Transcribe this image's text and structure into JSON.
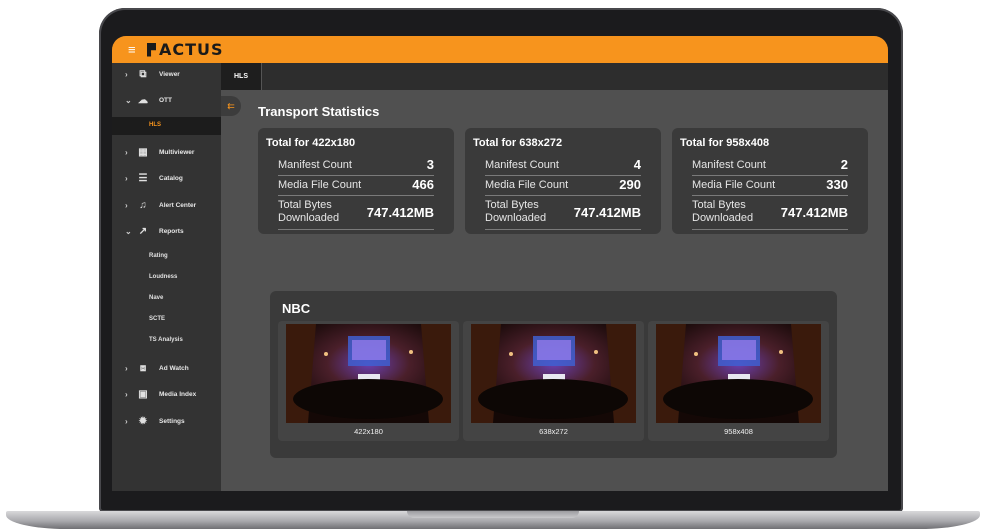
{
  "app": {
    "logo": "ACTUS",
    "menu_glyph": "≡",
    "accent_color": "#f7941d",
    "background": "#505050"
  },
  "sidebar": {
    "items": [
      {
        "label": "Viewer",
        "icon": "monitor-icon",
        "glyph": "⧉",
        "chevron": "›"
      },
      {
        "label": "OTT",
        "icon": "cloud-icon",
        "glyph": "☁",
        "chevron": "⌄"
      },
      {
        "label": "Multiviewer",
        "icon": "grid-icon",
        "glyph": "▦",
        "chevron": "›"
      },
      {
        "label": "Catalog",
        "icon": "list-icon",
        "glyph": "☰",
        "chevron": "›"
      },
      {
        "label": "Alert Center",
        "icon": "bell-icon",
        "glyph": "♫",
        "chevron": "›"
      },
      {
        "label": "Reports",
        "icon": "trend-icon",
        "glyph": "↗",
        "chevron": "⌄"
      },
      {
        "label": "Ad Watch",
        "icon": "ad-icon",
        "glyph": "⧈",
        "chevron": "›"
      },
      {
        "label": "Media Index",
        "icon": "film-icon",
        "glyph": "▣",
        "chevron": "›"
      },
      {
        "label": "Settings",
        "icon": "gear-icon",
        "glyph": "✹",
        "chevron": "›"
      }
    ],
    "ott_sub": [
      "HLS"
    ],
    "reports_sub": [
      "Rating",
      "Loudness",
      "Nave",
      "SCTE",
      "TS Analysis"
    ]
  },
  "tabs": [
    "HLS"
  ],
  "collapse_glyph": "⇇",
  "main": {
    "title": "Transport Statistics",
    "cards": [
      {
        "title": "Total for 422x180",
        "manifest_label": "Manifest Count",
        "manifest": "3",
        "media_label": "Media File Count",
        "media": "466",
        "bytes_label_1": "Total Bytes",
        "bytes_label_2": "Downloaded",
        "bytes": "747.412MB"
      },
      {
        "title": "Total for 638x272",
        "manifest_label": "Manifest Count",
        "manifest": "4",
        "media_label": "Media File Count",
        "media": "290",
        "bytes_label_1": "Total Bytes",
        "bytes_label_2": "Downloaded",
        "bytes": "747.412MB"
      },
      {
        "title": "Total for 958x408",
        "manifest_label": "Manifest Count",
        "manifest": "2",
        "media_label": "Media File Count",
        "media": "330",
        "bytes_label_1": "Total Bytes",
        "bytes_label_2": "Downloaded",
        "bytes": "747.412MB"
      }
    ],
    "channel": {
      "name": "NBC",
      "thumbnails": [
        "422x180",
        "638x272",
        "958x408"
      ]
    }
  }
}
